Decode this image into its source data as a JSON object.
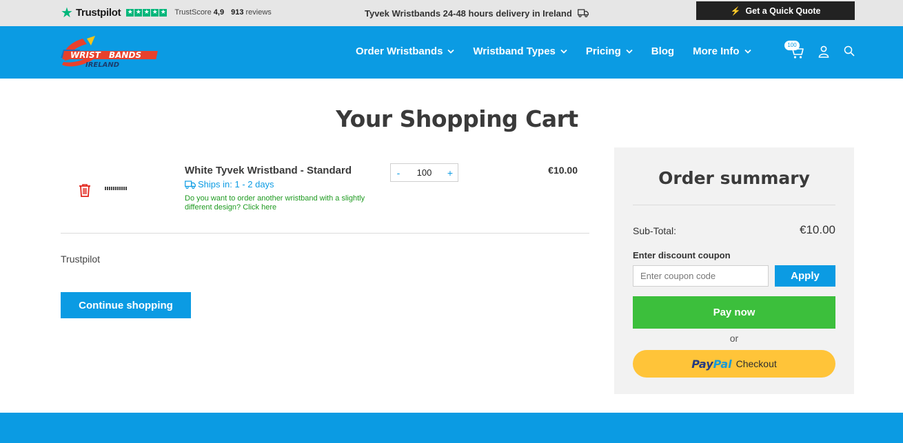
{
  "topbar": {
    "trustpilot_name": "Trustpilot",
    "trustscore_label": "TrustScore",
    "trustscore_value": "4,9",
    "reviews_count": "913",
    "reviews_label": "reviews",
    "delivery_text": "Tyvek Wristbands 24-48 hours delivery in Ireland",
    "quote_button": "Get a Quick Quote"
  },
  "nav": {
    "logo_line1a": "WRIST",
    "logo_line1b": "BANDS",
    "logo_line2": "IRELAND",
    "items": [
      {
        "label": "Order Wristbands",
        "has_dropdown": true
      },
      {
        "label": "Wristband Types",
        "has_dropdown": true
      },
      {
        "label": "Pricing",
        "has_dropdown": true
      },
      {
        "label": "Blog",
        "has_dropdown": false
      },
      {
        "label": "More Info",
        "has_dropdown": true
      }
    ],
    "cart_count": "100"
  },
  "main": {
    "title": "Your Shopping Cart",
    "cart_item": {
      "name": "White Tyvek Wristband - Standard",
      "ships": "Ships in: 1 - 2 days",
      "alt_link": "Do you want to order another wristband with a slightly different design? Click here",
      "quantity": "100",
      "minus": "-",
      "plus": "+",
      "price": "€10.00"
    },
    "trustpilot_widget": "Trustpilot",
    "continue_button": "Continue shopping"
  },
  "summary": {
    "title": "Order summary",
    "subtotal_label": "Sub-Total:",
    "subtotal_value": "€10.00",
    "coupon_label": "Enter discount coupon",
    "coupon_placeholder": "Enter coupon code",
    "apply_button": "Apply",
    "pay_button": "Pay now",
    "or_text": "or",
    "paypal_pay": "Pay",
    "paypal_pal": "Pal",
    "paypal_checkout": "Checkout"
  },
  "colors": {
    "brand_blue": "#0b9be3",
    "pay_green": "#3cbf3c",
    "paypal_yellow": "#ffc439",
    "trustpilot_green": "#00b67a"
  }
}
